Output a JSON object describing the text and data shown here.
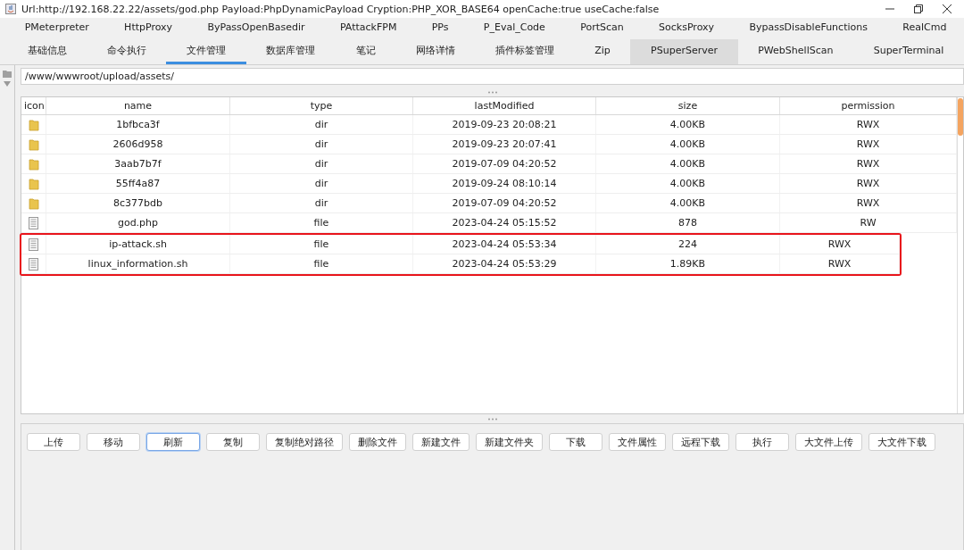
{
  "window": {
    "title": "Url:http://192.168.22.22/assets/god.php Payload:PhpDynamicPayload Cryption:PHP_XOR_BASE64 openCache:true useCache:false"
  },
  "plugin_tabs": [
    {
      "label": "PMeterpreter",
      "selected": false,
      "hovered": false
    },
    {
      "label": "HttpProxy",
      "selected": false,
      "hovered": false
    },
    {
      "label": "ByPassOpenBasedir",
      "selected": false,
      "hovered": false
    },
    {
      "label": "PAttackFPM",
      "selected": false,
      "hovered": false
    },
    {
      "label": "PPs",
      "selected": false,
      "hovered": false
    },
    {
      "label": "P_Eval_Code",
      "selected": false,
      "hovered": false
    },
    {
      "label": "PortScan",
      "selected": false,
      "hovered": false
    },
    {
      "label": "SocksProxy",
      "selected": false,
      "hovered": false
    },
    {
      "label": "BypassDisableFunctions",
      "selected": false,
      "hovered": false
    },
    {
      "label": "RealCmd",
      "selected": false,
      "hovered": false
    }
  ],
  "main_tabs": [
    {
      "label": "基础信息",
      "selected": false,
      "hovered": false
    },
    {
      "label": "命令执行",
      "selected": false,
      "hovered": false
    },
    {
      "label": "文件管理",
      "selected": true,
      "hovered": false
    },
    {
      "label": "数据库管理",
      "selected": false,
      "hovered": false
    },
    {
      "label": "笔记",
      "selected": false,
      "hovered": false
    },
    {
      "label": "网络详情",
      "selected": false,
      "hovered": false
    },
    {
      "label": "插件标签管理",
      "selected": false,
      "hovered": false
    },
    {
      "label": "Zip",
      "selected": false,
      "hovered": false
    },
    {
      "label": "PSuperServer",
      "selected": false,
      "hovered": true
    },
    {
      "label": "PWebShellScan",
      "selected": false,
      "hovered": false
    },
    {
      "label": "SuperTerminal",
      "selected": false,
      "hovered": false
    }
  ],
  "path_field": {
    "value": "/www/wwwroot/upload/assets/"
  },
  "table": {
    "columns": [
      "icon",
      "name",
      "type",
      "lastModified",
      "size",
      "permission"
    ],
    "rows": [
      {
        "kind": "dir",
        "name": "1bfbca3f",
        "type": "dir",
        "lastModified": "2019-09-23 20:08:21",
        "size": "4.00KB",
        "permission": "RWX",
        "highlighted": false
      },
      {
        "kind": "dir",
        "name": "2606d958",
        "type": "dir",
        "lastModified": "2019-09-23 20:07:41",
        "size": "4.00KB",
        "permission": "RWX",
        "highlighted": false
      },
      {
        "kind": "dir",
        "name": "3aab7b7f",
        "type": "dir",
        "lastModified": "2019-07-09 04:20:52",
        "size": "4.00KB",
        "permission": "RWX",
        "highlighted": false
      },
      {
        "kind": "dir",
        "name": "55ff4a87",
        "type": "dir",
        "lastModified": "2019-09-24 08:10:14",
        "size": "4.00KB",
        "permission": "RWX",
        "highlighted": false
      },
      {
        "kind": "dir",
        "name": "8c377bdb",
        "type": "dir",
        "lastModified": "2019-07-09 04:20:52",
        "size": "4.00KB",
        "permission": "RWX",
        "highlighted": false
      },
      {
        "kind": "file",
        "name": "god.php",
        "type": "file",
        "lastModified": "2023-04-24 05:15:52",
        "size": "878",
        "permission": "RW",
        "highlighted": false
      },
      {
        "kind": "file",
        "name": "ip-attack.sh",
        "type": "file",
        "lastModified": "2023-04-24 05:53:34",
        "size": "224",
        "permission": "RWX",
        "highlighted": true
      },
      {
        "kind": "file",
        "name": "linux_information.sh",
        "type": "file",
        "lastModified": "2023-04-24 05:53:29",
        "size": "1.89KB",
        "permission": "RWX",
        "highlighted": true
      }
    ]
  },
  "buttons": [
    {
      "label": "上传",
      "focused": false
    },
    {
      "label": "移动",
      "focused": false
    },
    {
      "label": "刷新",
      "focused": true
    },
    {
      "label": "复制",
      "focused": false
    },
    {
      "label": "复制绝对路径",
      "focused": false
    },
    {
      "label": "删除文件",
      "focused": false
    },
    {
      "label": "新建文件",
      "focused": false
    },
    {
      "label": "新建文件夹",
      "focused": false
    },
    {
      "label": "下载",
      "focused": false
    },
    {
      "label": "文件属性",
      "focused": false
    },
    {
      "label": "远程下载",
      "focused": false
    },
    {
      "label": "执行",
      "focused": false
    },
    {
      "label": "大文件上传",
      "focused": false
    },
    {
      "label": "大文件下载",
      "focused": false
    }
  ]
}
